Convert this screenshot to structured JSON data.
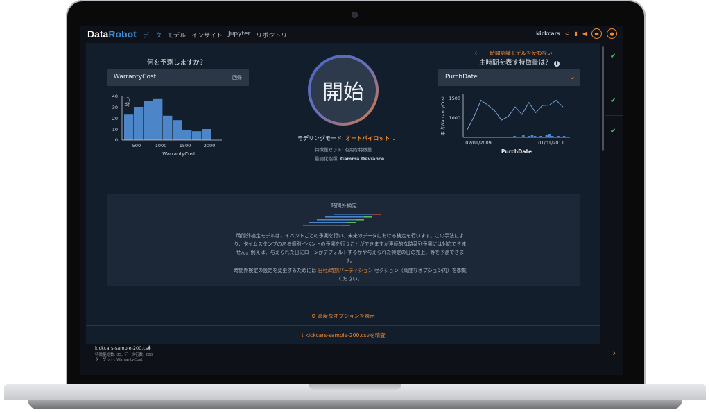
{
  "app": {
    "logo_main": "Data",
    "logo_accent": "Robot",
    "nav": [
      "データ",
      "モデル",
      "インサイト",
      "Jupyter",
      "リポジトリ"
    ],
    "project_name": "kickcars",
    "icons": [
      "share-icon",
      "book-icon",
      "megaphone-icon",
      "folder-icon",
      "user-icon"
    ]
  },
  "target": {
    "question": "何を予測しますか？",
    "value": "WarrantyCost",
    "type_tag": "回帰",
    "histogram": {
      "ylabel": "行数",
      "xlabel": "WarrantyCost",
      "y_ticks": [
        "40",
        "30",
        "20",
        "10",
        "0"
      ],
      "x_ticks": [
        "500",
        "1000",
        "1500",
        "2000"
      ]
    }
  },
  "time": {
    "back_link": "時間認識モデルを使わない",
    "question": "主時間を表す特徴量は？",
    "value": "PurchDate",
    "chart": {
      "ylabel": "平均WarrantyCost",
      "xlabel": "PurchDate",
      "y_ticks": [
        "1500",
        "1000"
      ],
      "x_ticks": [
        "02/01/2009",
        "01/01/2011"
      ]
    }
  },
  "start": {
    "label": "開始",
    "mode_label": "モデリングモード:",
    "mode_value": "オートパイロット",
    "feature_set": "特徴量セット: 有用な特徴量",
    "metric_label": "最適化指標:",
    "metric_value": "Gamma Deviance"
  },
  "panel": {
    "title": "時間外検定",
    "body": "時間外検定モデルは、イベントごとの予測を行い、未来のデータにおける検定を行います。この手法により、タイムスタンプのある個別イベントの予測を行うことができますが連続的な時系列予測には対応できません。例えば、与えられた日にローンがデフォルトするかや与えられた特定の日の売上、等を予測できます。",
    "body2_pre": "時間外検定の設定を変更するためには",
    "body2_link": "日付/時刻パーティション",
    "body2_post": "セクション（高度なオプション内）を御覧ください。"
  },
  "actions": {
    "advanced": "高度なオプションを表示",
    "explore": "kickcars-sample-200.csvを精査"
  },
  "footer": {
    "filename": "kickcars-sample-200.csv",
    "stats": "特徴量総数: 35, データ行数: 200",
    "target": "ターゲット: WarrantyCost"
  },
  "chart_data": [
    {
      "type": "bar",
      "title": "",
      "xlabel": "WarrantyCost",
      "ylabel": "行数",
      "categories": [
        "250-500",
        "500-750",
        "750-1000",
        "1000-1250",
        "1250-1500",
        "1500-1750",
        "1750-2000",
        "2000-2250",
        "2250-2500"
      ],
      "values": [
        23,
        30,
        35,
        37,
        22,
        18,
        9,
        8,
        10
      ],
      "ylim": [
        0,
        40
      ]
    },
    {
      "type": "line",
      "title": "",
      "xlabel": "PurchDate",
      "ylabel": "平均WarrantyCost",
      "x": [
        0,
        1,
        2,
        3,
        4,
        5,
        6,
        7,
        8,
        9,
        10,
        11,
        12,
        13,
        14
      ],
      "values": [
        700,
        1050,
        1480,
        1350,
        1200,
        950,
        1050,
        1300,
        1100,
        1420,
        1150,
        1340,
        1350,
        1480,
        1300
      ],
      "ylim": [
        600,
        1600
      ]
    }
  ]
}
